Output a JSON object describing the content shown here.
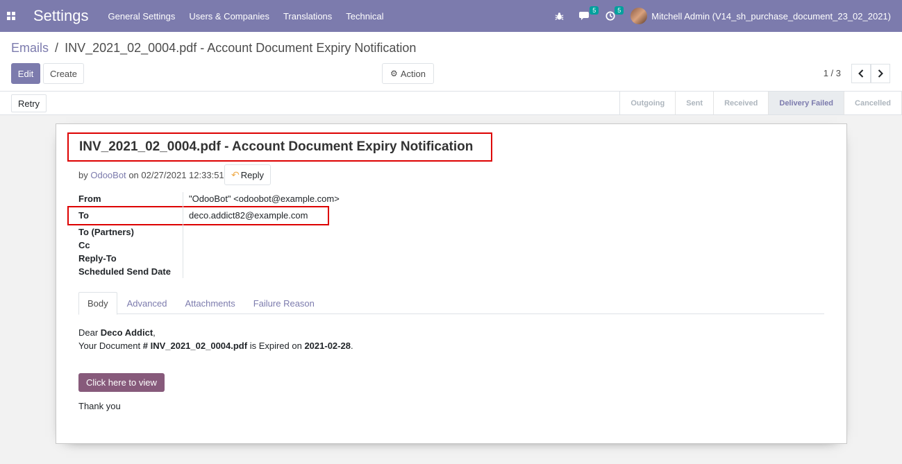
{
  "navbar": {
    "brand": "Settings",
    "menu": [
      "General Settings",
      "Users & Companies",
      "Translations",
      "Technical"
    ],
    "chat_badge": "5",
    "activity_badge": "5",
    "user_name": "Mitchell Admin (V14_sh_purchase_document_23_02_2021)"
  },
  "breadcrumb": {
    "parent": "Emails",
    "separator": "/",
    "current": "INV_2021_02_0004.pdf - Account Document Expiry Notification"
  },
  "buttons": {
    "edit": "Edit",
    "create": "Create",
    "action": "Action",
    "retry": "Retry",
    "reply": "Reply",
    "view": "Click here to view"
  },
  "pager": {
    "text": "1 / 3"
  },
  "status_steps": [
    {
      "label": "Outgoing"
    },
    {
      "label": "Sent"
    },
    {
      "label": "Received"
    },
    {
      "label": "Delivery Failed"
    },
    {
      "label": "Cancelled"
    }
  ],
  "mail": {
    "subject": "INV_2021_02_0004.pdf - Account Document Expiry Notification",
    "by_prefix": "by",
    "author": "OdooBot",
    "date": "on 02/27/2021 12:33:51",
    "fields": {
      "from_label": "From",
      "from_value": "\"OdooBot\" <odoobot@example.com>",
      "to_label": "To",
      "to_value": "deco.addict82@example.com",
      "to_partners_label": "To (Partners)",
      "cc_label": "Cc",
      "reply_to_label": "Reply-To",
      "scheduled_label": "Scheduled Send Date"
    },
    "tabs": [
      "Body",
      "Advanced",
      "Attachments",
      "Failure Reason"
    ],
    "body": {
      "dear": "Dear ",
      "customer": "Deco Addict",
      "comma": ",",
      "doc_prefix": "Your Document ",
      "doc_name": "# INV_2021_02_0004.pdf",
      "expired_text": " is Expired on ",
      "expiry_date": "2021-02-28",
      "period": ".",
      "thanks": "Thank you"
    }
  },
  "colors": {
    "brand": "#7c7bad",
    "highlight": "#dd0000",
    "view_button": "#875a7b"
  }
}
